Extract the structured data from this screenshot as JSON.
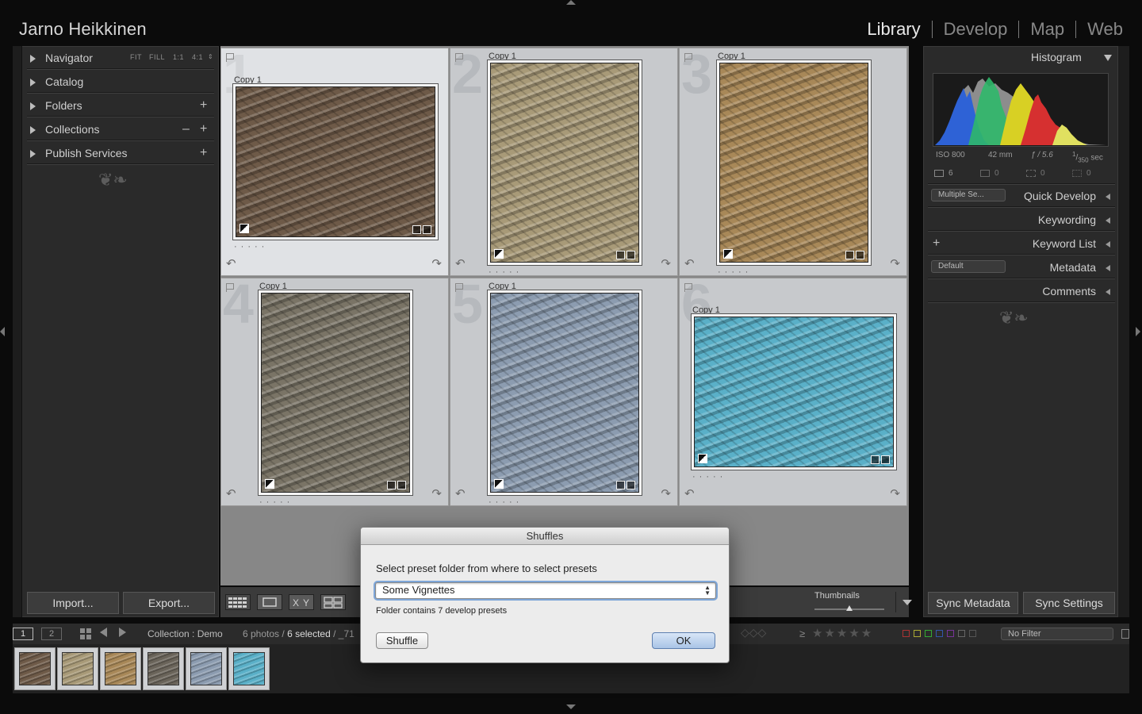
{
  "identity_plate": "Jarno Heikkinen",
  "modules": [
    "Library",
    "Develop",
    "Map",
    "Web"
  ],
  "active_module": "Library",
  "left_panel": {
    "navigator": {
      "label": "Navigator",
      "zoom_options": [
        "FIT",
        "FILL",
        "1:1",
        "4:1"
      ]
    },
    "catalog": "Catalog",
    "folders": "Folders",
    "collections": "Collections",
    "publish_services": "Publish Services",
    "import_label": "Import...",
    "export_label": "Export..."
  },
  "grid": {
    "cells": [
      {
        "index": "1",
        "copy": "Copy 1",
        "color": "#6e5a48",
        "selected": true
      },
      {
        "index": "2",
        "copy": "Copy 1",
        "color": "#a89a78",
        "selected": false
      },
      {
        "index": "3",
        "copy": "Copy 1",
        "color": "#a88858",
        "selected": false
      },
      {
        "index": "4",
        "copy": "Copy 1",
        "color": "#7a7466",
        "selected": false
      },
      {
        "index": "5",
        "copy": "Copy 1",
        "color": "#8c9cb0",
        "selected": false
      },
      {
        "index": "6",
        "copy": "Copy 1",
        "color": "#5ab0c8",
        "selected": false
      }
    ]
  },
  "toolbar": {
    "thumbnails_label": "Thumbnails",
    "thumbnail_size": 0.5
  },
  "right_panel": {
    "histogram_label": "Histogram",
    "exif": {
      "iso": "ISO 800",
      "focal": "42 mm",
      "aperture": "ƒ / 5.6",
      "shutter_num": "1",
      "shutter_den": "350",
      "shutter_unit": "sec"
    },
    "counts": [
      "6",
      "0",
      "0",
      "0"
    ],
    "quick_develop": {
      "preset": "Multiple Se...",
      "label": "Quick Develop"
    },
    "keywording": "Keywording",
    "keyword_list": "Keyword List",
    "metadata": {
      "preset": "Default",
      "label": "Metadata"
    },
    "comments": "Comments",
    "sync_metadata": "Sync Metadata",
    "sync_settings": "Sync Settings"
  },
  "filmstrip": {
    "page1": "1",
    "page2": "2",
    "source": "Collection : Demo",
    "count_text": "6 photos /",
    "selected_text": "6 selected",
    "path_text": "/ _71",
    "filter_symbol": "≥",
    "filter_label": "No Filter",
    "thumbs": [
      "#6e5a48",
      "#a89a78",
      "#a88858",
      "#6a645a",
      "#8c9cb0",
      "#5ab0c8"
    ]
  },
  "dialog": {
    "title": "Shuffles",
    "prompt": "Select preset folder from where to select presets",
    "selected_folder": "Some Vignettes",
    "info": "Folder contains 7 develop presets",
    "shuffle_label": "Shuffle",
    "ok_label": "OK"
  }
}
